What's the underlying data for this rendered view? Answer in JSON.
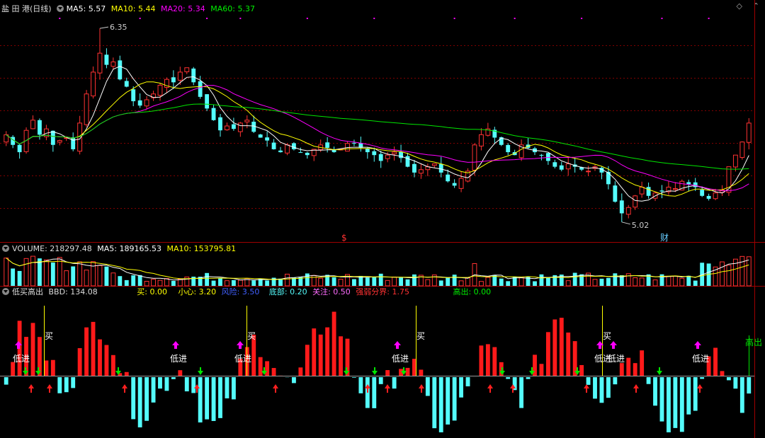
{
  "main": {
    "stock_name": "盐 田 港(日线)",
    "ma5": "MA5: 5.57",
    "ma10": "MA10: 5.44",
    "ma20": "MA20: 5.34",
    "ma60": "MA60: 5.37",
    "high_label": "6.35",
    "low_label": "5.02",
    "marker_s": "$",
    "marker_cai": "财"
  },
  "volume": {
    "title": "VOLUME: 218297.48",
    "ma5": "MA5: 189165.53",
    "ma10": "MA10: 153795.81"
  },
  "indicator": {
    "title": "低买高出",
    "bbd": "BBD: 134.08",
    "buy": "买: 0.00",
    "careful": "小心: 3.20",
    "risk": "风险: 3.50",
    "bottom": "底部: 0.20",
    "watch": "关注: 0.50",
    "strength": "强弱分界: 1.75",
    "sell_high": "高出: 0.00",
    "signal_low_buy": "低进",
    "signal_buy": "买",
    "signal_sell": "高出"
  },
  "colors": {
    "up": "#ff3232",
    "down": "#54fcfc",
    "ma5": "#ffffff",
    "ma10": "#ffff00",
    "ma20": "#ff00ff",
    "ma60": "#00e600",
    "grid": "#800000"
  },
  "chart_data": {
    "type": "candlestick",
    "price_high": 6.35,
    "price_low": 5.02,
    "ma_last": {
      "MA5": 5.57,
      "MA10": 5.44,
      "MA20": 5.34,
      "MA60": 5.37
    },
    "volume_last": 218297.48,
    "volume_ma5": 189165.53,
    "volume_ma10": 153795.81,
    "indicator_params": {
      "BBD": 134.08,
      "买": 0.0,
      "小心": 3.2,
      "风险": 3.5,
      "底部": 0.2,
      "关注": 0.5,
      "强弱分界": 1.75,
      "高出": 0.0
    },
    "closes": [
      5.62,
      5.55,
      5.5,
      5.65,
      5.72,
      5.62,
      5.66,
      5.55,
      5.58,
      5.6,
      5.52,
      5.7,
      5.9,
      6.05,
      6.18,
      6.1,
      6.12,
      6.0,
      5.95,
      5.85,
      5.82,
      5.86,
      5.9,
      5.96,
      6.0,
      5.98,
      6.05,
      6.08,
      5.98,
      5.88,
      5.8,
      5.72,
      5.65,
      5.68,
      5.66,
      5.7,
      5.72,
      5.64,
      5.6,
      5.58,
      5.52,
      5.5,
      5.55,
      5.52,
      5.5,
      5.48,
      5.52,
      5.55,
      5.53,
      5.5,
      5.52,
      5.56,
      5.56,
      5.53,
      5.5,
      5.48,
      5.44,
      5.48,
      5.5,
      5.46,
      5.4,
      5.36,
      5.38,
      5.4,
      5.42,
      5.36,
      5.3,
      5.27,
      5.32,
      5.37,
      5.55,
      5.62,
      5.66,
      5.6,
      5.55,
      5.5,
      5.48,
      5.55,
      5.53,
      5.5,
      5.48,
      5.44,
      5.4,
      5.38,
      5.42,
      5.4,
      5.38,
      5.37,
      5.4,
      5.36,
      5.28,
      5.16,
      5.08,
      5.12,
      5.2,
      5.26,
      5.2,
      5.22,
      5.23,
      5.26,
      5.25,
      5.3,
      5.28,
      5.26,
      5.2,
      5.18,
      5.22,
      5.24,
      5.4,
      5.48,
      5.57,
      5.7
    ]
  }
}
